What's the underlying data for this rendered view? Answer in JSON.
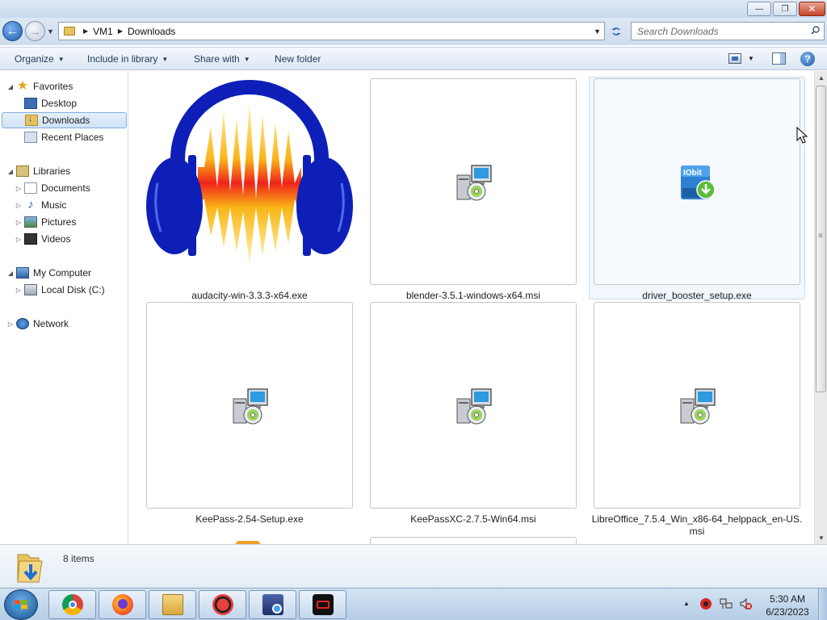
{
  "window": {
    "min_glyph": "—",
    "max_glyph": "❐",
    "close_glyph": "✕"
  },
  "nav": {
    "back_glyph": "←",
    "forward_glyph": "→",
    "breadcrumbs": [
      "VM1",
      "Downloads"
    ],
    "breadcrumb_sep": "▶",
    "search_placeholder": "Search Downloads"
  },
  "toolbar": {
    "organize": "Organize",
    "include_in_library": "Include in library",
    "share_with": "Share with",
    "new_folder": "New folder",
    "help_glyph": "?"
  },
  "sidebar": {
    "favorites": {
      "label": "Favorites",
      "items": [
        {
          "label": "Desktop",
          "icon": "desktop-icon"
        },
        {
          "label": "Downloads",
          "icon": "downloads-folder-icon",
          "selected": true
        },
        {
          "label": "Recent Places",
          "icon": "recent-places-icon"
        }
      ]
    },
    "libraries": {
      "label": "Libraries",
      "items": [
        {
          "label": "Documents",
          "icon": "documents-icon"
        },
        {
          "label": "Music",
          "icon": "music-icon"
        },
        {
          "label": "Pictures",
          "icon": "pictures-icon"
        },
        {
          "label": "Videos",
          "icon": "videos-icon"
        }
      ]
    },
    "computer": {
      "label": "My Computer",
      "items": [
        {
          "label": "Local Disk (C:)",
          "icon": "local-disk-icon"
        }
      ]
    },
    "network": {
      "label": "Network"
    }
  },
  "files": [
    {
      "name": "audacity-win-3.3.3-x64.exe",
      "icon": "audacity-icon"
    },
    {
      "name": "blender-3.5.1-windows-x64.msi",
      "icon": "msi-installer-icon"
    },
    {
      "name": "driver_booster_setup.exe",
      "icon": "iobit-icon",
      "icon_text": "IObit"
    },
    {
      "name": "KeePass-2.54-Setup.exe",
      "icon": "msi-installer-icon"
    },
    {
      "name": "KeePassXC-2.7.5-Win64.msi",
      "icon": "msi-installer-icon"
    },
    {
      "name": "LibreOffice_7.5.4_Win_x86-64_helppack_en-US.msi",
      "icon": "msi-installer-icon"
    }
  ],
  "details": {
    "count": "8 items"
  },
  "taskbar": {
    "apps": [
      {
        "name": "Google Chrome",
        "icon": "chrome-icon"
      },
      {
        "name": "Firefox",
        "icon": "firefox-icon"
      },
      {
        "name": "Windows Explorer",
        "icon": "explorer-icon"
      },
      {
        "name": "Driver Booster",
        "icon": "driver-booster-icon"
      },
      {
        "name": "Remote Desktop",
        "icon": "remote-desktop-icon"
      },
      {
        "name": "Screen Recorder",
        "icon": "screen-recorder-icon"
      }
    ],
    "time": "5:30 AM",
    "date": "6/23/2023"
  }
}
